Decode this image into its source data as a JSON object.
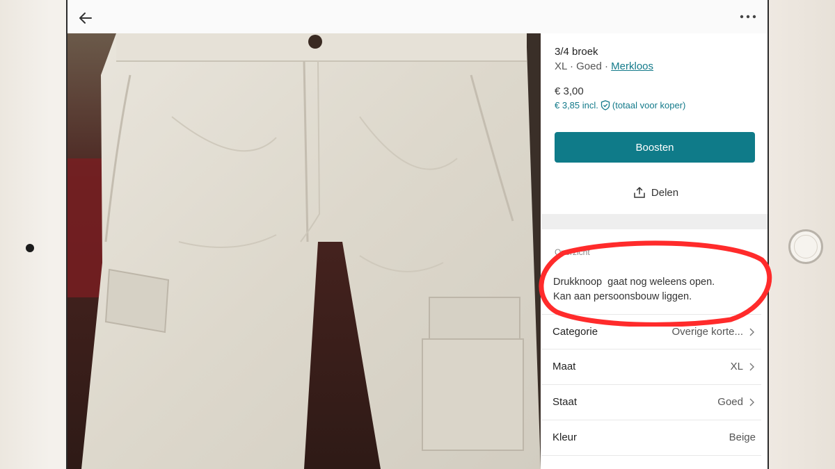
{
  "topbar": {
    "back_icon": "arrow-left-icon",
    "more_icon": "more-horizontal-icon"
  },
  "item": {
    "title": "3/4 broek",
    "size_condition": "XL · Goed · ",
    "brand": "Merkloos",
    "price": "€ 3,00",
    "price_incl": "€ 3,85 incl.",
    "buyer_total": "(totaal voor koper)"
  },
  "actions": {
    "boost_label": "Boosten",
    "share_label": "Delen"
  },
  "overview": {
    "label": "Overzicht",
    "description_lines": [
      "Drukknoop  gaat nog weleens open.",
      "Kan aan persoonsbouw liggen."
    ]
  },
  "attributes": [
    {
      "label": "Categorie",
      "value": "Overige korte...",
      "chevron": true
    },
    {
      "label": "Maat",
      "value": "XL",
      "chevron": true
    },
    {
      "label": "Staat",
      "value": "Goed",
      "chevron": true
    },
    {
      "label": "Kleur",
      "value": "Beige",
      "chevron": false
    }
  ],
  "colors": {
    "accent": "#0f7b89",
    "annotation": "#ff2b2b",
    "fabric": "#e3ded2"
  }
}
